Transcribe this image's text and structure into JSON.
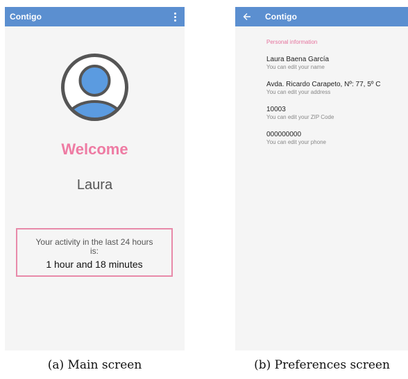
{
  "main_screen": {
    "app_title": "Contigo",
    "menu_icon": "more-vert-icon",
    "avatar_icon": "account-circle-icon",
    "welcome": "Welcome",
    "user_name": "Laura",
    "activity_label": "Your activity in the last 24 hours is:",
    "activity_value": "1 hour and 18 minutes"
  },
  "prefs_screen": {
    "app_title": "Contigo",
    "back_icon": "arrow-back-icon",
    "section_header": "Personal information",
    "items": [
      {
        "title": "Laura Baena García",
        "summary": "You can edit your name"
      },
      {
        "title": "Avda. Ricardo Carapeto, Nº: 77, 5º C",
        "summary": "You can edit your address"
      },
      {
        "title": "10003",
        "summary": "You can edit your ZIP Code"
      },
      {
        "title": "000000000",
        "summary": "You can edit your phone"
      }
    ]
  },
  "captions": {
    "a": "(a) Main screen",
    "b": "(b) Preferences screen"
  },
  "colors": {
    "appbar": "#5b8fd0",
    "accent_pink": "#ee7ba3",
    "box_border": "#e88aa9",
    "background": "#f5f5f5"
  }
}
